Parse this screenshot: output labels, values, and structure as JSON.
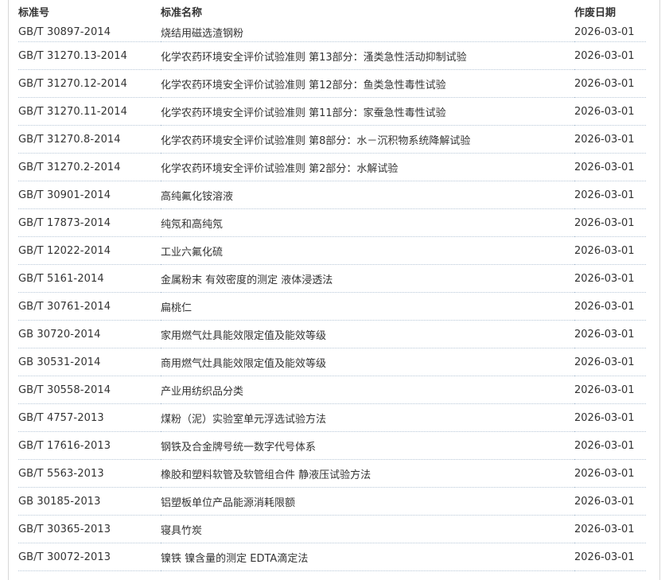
{
  "table": {
    "headers": {
      "code": "标准号",
      "name": "标准名称",
      "date": "作废日期"
    },
    "rows": [
      {
        "code": "GB/T 30897-2014",
        "name": "烧结用磁选渣钢粉",
        "date": "2026-03-01"
      },
      {
        "code": "GB/T 31270.13-2014",
        "name": "化学农药环境安全评价试验准则 第13部分：溞类急性活动抑制试验",
        "date": "2026-03-01"
      },
      {
        "code": "GB/T 31270.12-2014",
        "name": "化学农药环境安全评价试验准则 第12部分：鱼类急性毒性试验",
        "date": "2026-03-01"
      },
      {
        "code": "GB/T 31270.11-2014",
        "name": "化学农药环境安全评价试验准则 第11部分：家蚕急性毒性试验",
        "date": "2026-03-01"
      },
      {
        "code": "GB/T 31270.8-2014",
        "name": "化学农药环境安全评价试验准则 第8部分：水－沉积物系统降解试验",
        "date": "2026-03-01"
      },
      {
        "code": "GB/T 31270.2-2014",
        "name": "化学农药环境安全评价试验准则 第2部分：水解试验",
        "date": "2026-03-01"
      },
      {
        "code": "GB/T 30901-2014",
        "name": "高纯氟化铵溶液",
        "date": "2026-03-01"
      },
      {
        "code": "GB/T 17873-2014",
        "name": "纯氖和高纯氖",
        "date": "2026-03-01"
      },
      {
        "code": "GB/T 12022-2014",
        "name": "工业六氟化硫",
        "date": "2026-03-01"
      },
      {
        "code": "GB/T 5161-2014",
        "name": "金属粉末 有效密度的测定 液体浸透法",
        "date": "2026-03-01"
      },
      {
        "code": "GB/T 30761-2014",
        "name": "扁桃仁",
        "date": "2026-03-01"
      },
      {
        "code": "GB 30720-2014",
        "name": "家用燃气灶具能效限定值及能效等级",
        "date": "2026-03-01"
      },
      {
        "code": "GB 30531-2014",
        "name": "商用燃气灶具能效限定值及能效等级",
        "date": "2026-03-01"
      },
      {
        "code": "GB/T 30558-2014",
        "name": "产业用纺织品分类",
        "date": "2026-03-01"
      },
      {
        "code": "GB/T 4757-2013",
        "name": "煤粉（泥）实验室单元浮选试验方法",
        "date": "2026-03-01"
      },
      {
        "code": "GB/T 17616-2013",
        "name": "钢铁及合金牌号统一数字代号体系",
        "date": "2026-03-01"
      },
      {
        "code": "GB/T 5563-2013",
        "name": "橡胶和塑料软管及软管组合件 静液压试验方法",
        "date": "2026-03-01"
      },
      {
        "code": "GB 30185-2013",
        "name": "铝塑板单位产品能源消耗限额",
        "date": "2026-03-01"
      },
      {
        "code": "GB/T 30365-2013",
        "name": "寝具竹炭",
        "date": "2026-03-01"
      },
      {
        "code": "GB/T 30072-2013",
        "name": "镍铁 镍含量的测定 EDTA滴定法",
        "date": "2026-03-01"
      }
    ]
  }
}
